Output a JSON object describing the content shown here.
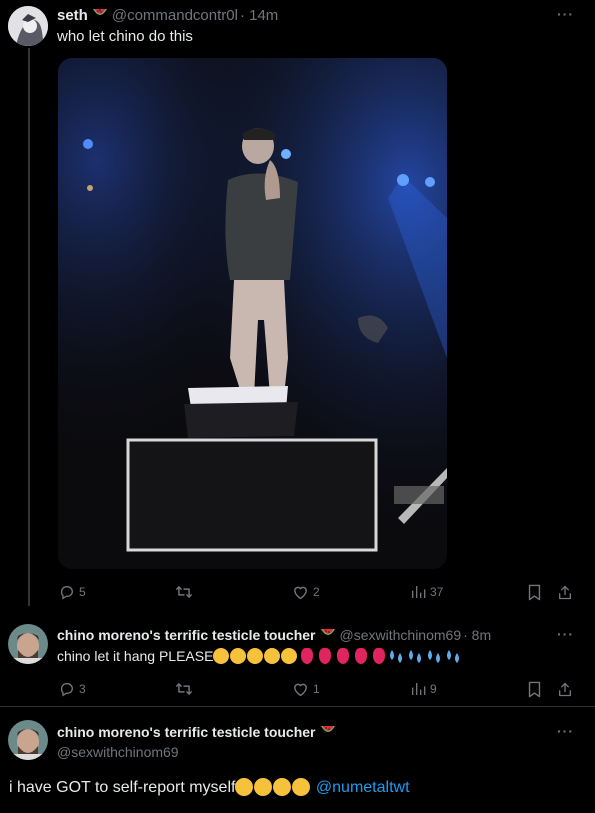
{
  "tweet1": {
    "name": "seth",
    "handle": "@commandcontr0l",
    "time": "· 14m",
    "text": "who let chino do this",
    "stats": {
      "replies": "5",
      "likes": "2",
      "views": "37"
    }
  },
  "tweet2": {
    "name": "chino moreno's terrific testicle toucher",
    "handle": "@sexwithchinom69",
    "time": "· 8m",
    "text": "chino let it hang PLEASE",
    "stats": {
      "replies": "3",
      "likes": "1",
      "views": "9"
    }
  },
  "tweet3": {
    "name": "chino moreno's terrific testicle toucher",
    "handle": "@sexwithchinom69",
    "text": "i have GOT to self-report myself",
    "mention": "@numetaltwt"
  },
  "icons": {
    "name_emoji": "watermelon-icon",
    "more": "more-icon",
    "reply": "reply-icon",
    "retweet": "retweet-icon",
    "like": "like-icon",
    "views": "views-icon",
    "bookmark": "bookmark-icon",
    "share": "share-icon"
  },
  "colors": {
    "background": "#000000",
    "muted": "#71767b",
    "link": "#1d9bf0",
    "text": "#e7e9ea"
  }
}
